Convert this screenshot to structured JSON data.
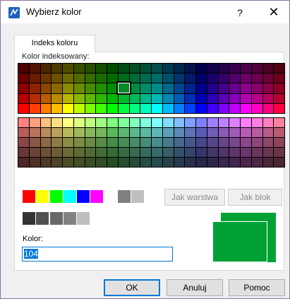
{
  "window": {
    "title": "Wybierz kolor",
    "help_glyph": "?",
    "close_glyph": "✕"
  },
  "tabs": [
    {
      "label": "Indeks koloru",
      "active": true
    }
  ],
  "palette": {
    "label": "Kolor indeksowany:",
    "selected_index": 104
  },
  "buttons": {
    "by_layer": "Jak warstwa",
    "by_block": "Jak blok",
    "ok": "OK",
    "cancel": "Anuluj",
    "help": "Pomoc"
  },
  "kolor": {
    "label": "Kolor:",
    "value": "104"
  },
  "preview": {
    "color": "#00a236"
  },
  "standard_colors": [
    "#ff0000",
    "#ffff00",
    "#00ff00",
    "#00ffff",
    "#0000ff",
    "#ff00ff",
    "#ffffff",
    "#808080",
    "#c0c0c0"
  ],
  "gray_colors": [
    "#333333",
    "#505050",
    "#696969",
    "#828282",
    "#bebebe",
    "#ffffff"
  ]
}
